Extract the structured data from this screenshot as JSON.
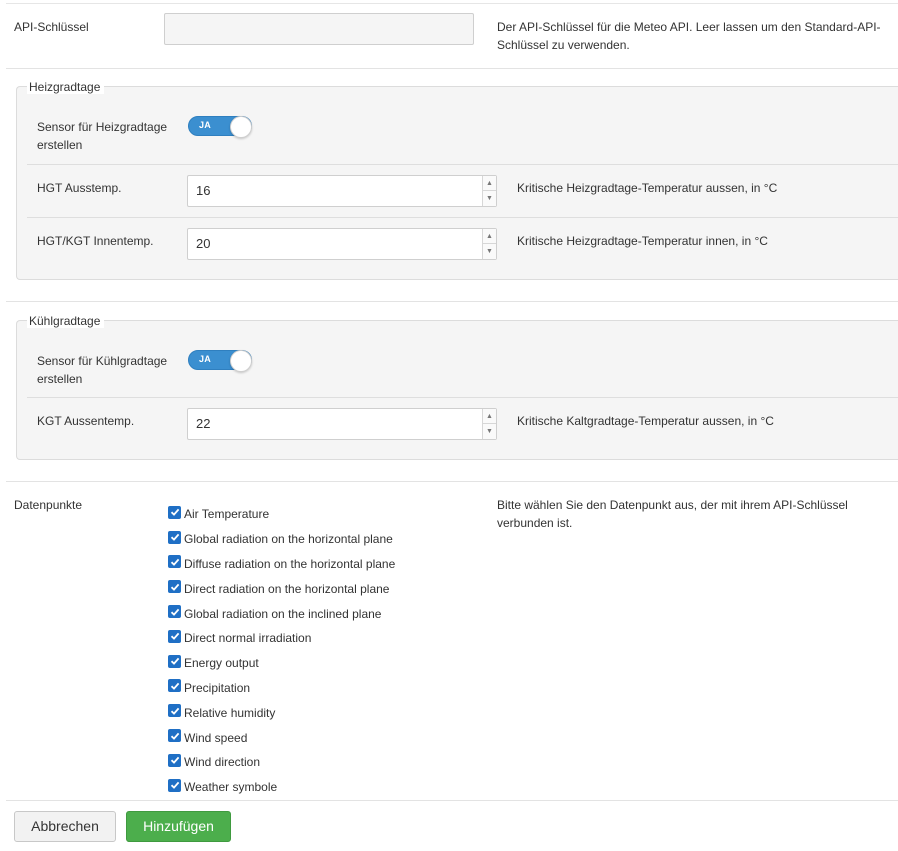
{
  "api_key": {
    "label": "API-Schlüssel",
    "value": "",
    "placeholder": "",
    "help_line1": "Der API-Schlüssel für die Meteo API. Leer lassen um den Standard-API-",
    "help_line2": "Schlüssel zu verwenden."
  },
  "heating": {
    "legend": "Heizgradtage",
    "sensor_label_line1": "Sensor für Heizgradtage",
    "sensor_label_line2": "erstellen",
    "toggle_text": "JA",
    "outside_temp": {
      "label": "HGT Ausstemp.",
      "value": "16",
      "help": "Kritische Heizgradtage-Temperatur aussen, in °C"
    },
    "inside_temp": {
      "label": "HGT/KGT Innentemp.",
      "value": "20",
      "help": "Kritische Heizgradtage-Temperatur innen, in °C"
    }
  },
  "cooling": {
    "legend": "Kühlgradtage",
    "sensor_label_line1": "Sensor für Kühlgradtage",
    "sensor_label_line2": "erstellen",
    "toggle_text": "JA",
    "outside_temp": {
      "label": "KGT Aussentemp.",
      "value": "22",
      "help": "Kritische Kaltgradtage-Temperatur aussen, in °C"
    }
  },
  "datapoints": {
    "label": "Datenpunkte",
    "help_line1": "Bitte wählen Sie den Datenpunkt aus, der mit ihrem API-Schlüssel",
    "help_line2": "verbunden ist.",
    "items": [
      {
        "label": "Air Temperature",
        "checked": true
      },
      {
        "label": "Global radiation on the horizontal plane",
        "checked": true
      },
      {
        "label": "Diffuse radiation on the horizontal plane",
        "checked": true
      },
      {
        "label": "Direct radiation on the horizontal plane",
        "checked": true
      },
      {
        "label": "Global radiation on the inclined plane",
        "checked": true
      },
      {
        "label": "Direct normal irradiation",
        "checked": true
      },
      {
        "label": "Energy output",
        "checked": true
      },
      {
        "label": "Precipitation",
        "checked": true
      },
      {
        "label": "Relative humidity",
        "checked": true
      },
      {
        "label": "Wind speed",
        "checked": true
      },
      {
        "label": "Wind direction",
        "checked": true
      },
      {
        "label": "Weather symbole",
        "checked": true
      }
    ]
  },
  "footer": {
    "cancel_label": "Abbrechen",
    "add_label": "Hinzufügen"
  },
  "colors": {
    "toggle_on": "#3b8fd0",
    "checkbox": "#1f6fc5",
    "primary_button": "#4cae4c"
  }
}
